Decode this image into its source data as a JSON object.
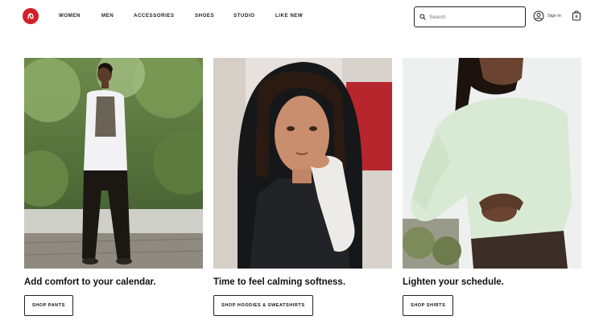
{
  "brand": {
    "accent": "#d31f2b"
  },
  "nav": {
    "items": [
      "WOMEN",
      "MEN",
      "ACCESSORIES",
      "SHOES",
      "STUDIO",
      "LIKE NEW"
    ]
  },
  "search": {
    "placeholder": "Search",
    "icon": "search-icon"
  },
  "account": {
    "signin_label": "Sign in",
    "icon": "user-icon"
  },
  "cart": {
    "icon": "shopping-bag-icon"
  },
  "cards": [
    {
      "headline": "Add comfort to your calendar.",
      "cta": "SHOP PANTS"
    },
    {
      "headline": "Time to feel calming softness.",
      "cta": "SHOP HOODIES & SWEATSHIRTS"
    },
    {
      "headline": "Lighten your schedule.",
      "cta": "SHOP SHIRTS"
    }
  ]
}
